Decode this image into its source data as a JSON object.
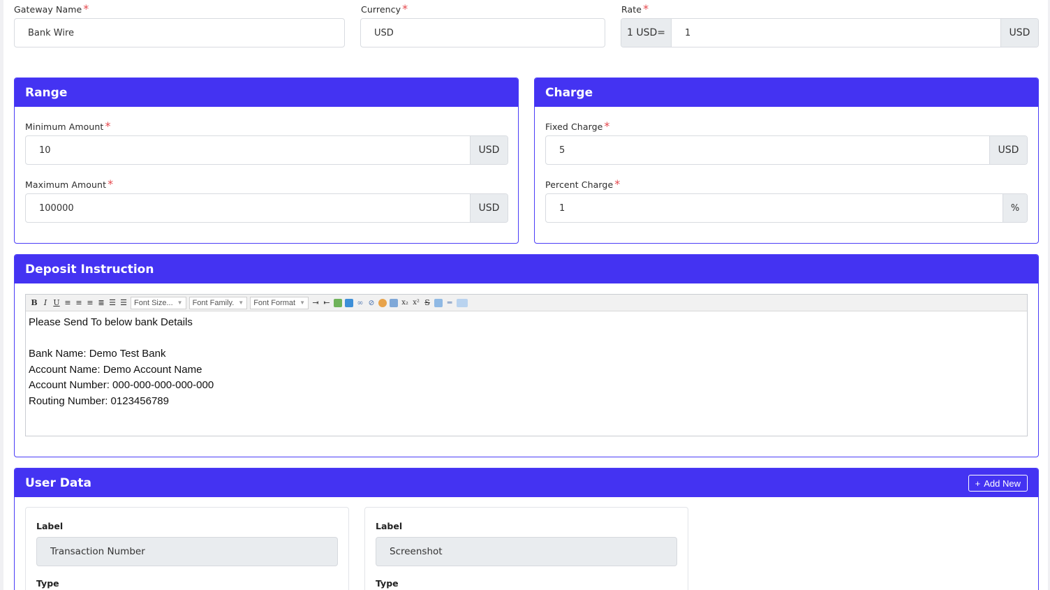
{
  "top": {
    "gateway_label": "Gateway Name",
    "gateway_value": "Bank Wire",
    "currency_label": "Currency",
    "currency_value": "USD",
    "rate_label": "Rate",
    "rate_prefix": "1 USD=",
    "rate_value": "1",
    "rate_suffix": "USD",
    "required_mark": "*"
  },
  "range": {
    "title": "Range",
    "min_label": "Minimum Amount",
    "min_value": "10",
    "min_unit": "USD",
    "max_label": "Maximum Amount",
    "max_value": "100000",
    "max_unit": "USD"
  },
  "charge": {
    "title": "Charge",
    "fixed_label": "Fixed Charge",
    "fixed_value": "5",
    "fixed_unit": "USD",
    "percent_label": "Percent Charge",
    "percent_value": "1",
    "percent_unit": "%"
  },
  "deposit": {
    "title": "Deposit Instruction",
    "toolbar": {
      "font_size": "Font Size...",
      "font_family": "Font Family.",
      "font_format": "Font Format"
    },
    "lines": [
      "Please Send To below bank Details",
      "",
      "Bank Name: Demo Test Bank",
      "Account Name: Demo Account Name",
      "Account Number: 000-000-000-000-000",
      "Routing Number: 0123456789"
    ]
  },
  "user_data": {
    "title": "User Data",
    "add_new_label": "Add New",
    "fields": [
      {
        "label_caption": "Label",
        "label_value": "Transaction Number",
        "type_caption": "Type"
      },
      {
        "label_caption": "Label",
        "label_value": "Screenshot",
        "type_caption": "Type"
      }
    ]
  },
  "colors": {
    "primary": "#4433f2",
    "required": "#e5484d",
    "addon_bg": "#e9ecef"
  }
}
